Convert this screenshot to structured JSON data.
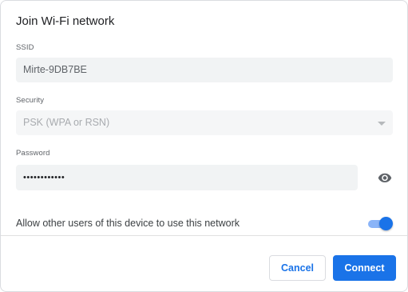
{
  "dialog": {
    "title": "Join Wi-Fi network"
  },
  "ssid": {
    "label": "SSID",
    "value": "Mirte-9DB7BE"
  },
  "security": {
    "label": "Security",
    "value": "PSK (WPA or RSN)",
    "icon": "chevron-down-icon"
  },
  "password": {
    "label": "Password",
    "value": "••••••••••••",
    "reveal_icon": "eye-icon"
  },
  "share": {
    "label": "Allow other users of this device to use this network",
    "enabled": true
  },
  "actions": {
    "cancel_label": "Cancel",
    "connect_label": "Connect"
  },
  "colors": {
    "accent": "#1a73e8",
    "field_bg": "#f1f3f4",
    "toggle_track": "#8ab4f8"
  }
}
